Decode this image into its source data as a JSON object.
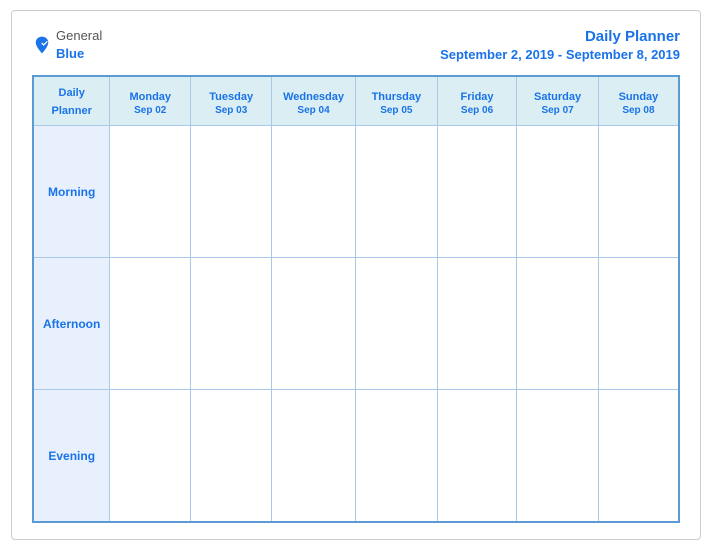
{
  "logo": {
    "general": "General",
    "blue": "Blue"
  },
  "title": {
    "main": "Daily Planner",
    "sub": "September 2, 2019 - September 8, 2019"
  },
  "columns": [
    {
      "label": "Daily\nPlanner",
      "date": ""
    },
    {
      "label": "Monday",
      "date": "Sep 02"
    },
    {
      "label": "Tuesday",
      "date": "Sep 03"
    },
    {
      "label": "Wednesday",
      "date": "Sep 04"
    },
    {
      "label": "Thursday",
      "date": "Sep 05"
    },
    {
      "label": "Friday",
      "date": "Sep 06"
    },
    {
      "label": "Saturday",
      "date": "Sep 07"
    },
    {
      "label": "Sunday",
      "date": "Sep 08"
    }
  ],
  "rows": [
    {
      "label": "Morning"
    },
    {
      "label": "Afternoon"
    },
    {
      "label": "Evening"
    }
  ]
}
